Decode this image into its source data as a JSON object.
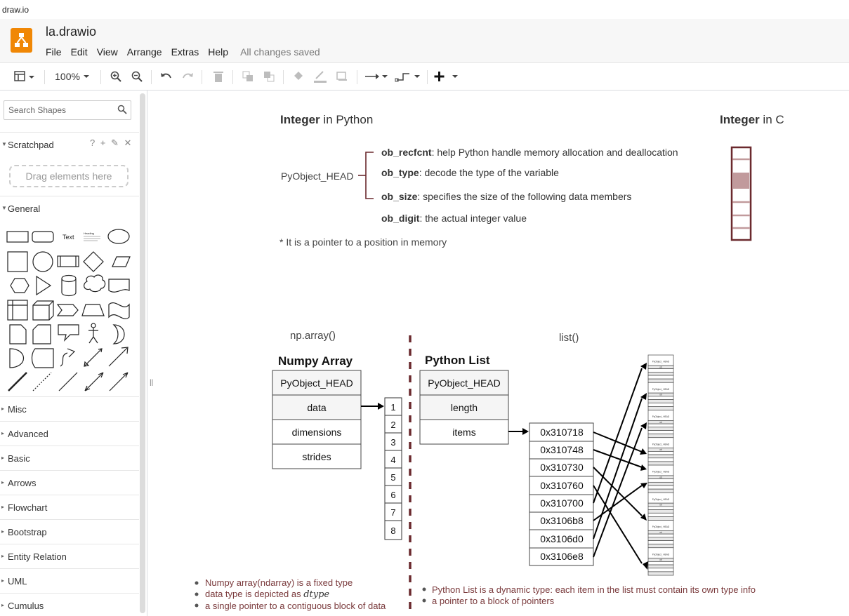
{
  "app": {
    "window_title": "draw.io",
    "doc_title": "la.drawio",
    "save_status": "All changes saved"
  },
  "menu": [
    "File",
    "Edit",
    "View",
    "Arrange",
    "Extras",
    "Help"
  ],
  "toolbar": {
    "zoom": "100%"
  },
  "sidebar": {
    "search_placeholder": "Search Shapes",
    "scratchpad": "Scratchpad",
    "scratchpad_icons": "? + ✎ ✕",
    "drop_hint": "Drag elements here",
    "general": "General",
    "palette_text": "Text",
    "palette_heading": "Heading",
    "sections": [
      "Misc",
      "Advanced",
      "Basic",
      "Arrows",
      "Flowchart",
      "Bootstrap",
      "Entity Relation",
      "UML",
      "Cumulus"
    ]
  },
  "diagram": {
    "int_py_bold": "Integer",
    "int_py_rest": " in Python",
    "int_c_bold": "Integer",
    "int_c_rest": " in C",
    "pyobj_head": "PyObject_HEAD",
    "fields": [
      {
        "name": "ob_recfcnt",
        "desc": ": help Python handle memory allocation and deallocation"
      },
      {
        "name": "ob_type",
        "desc": ": decode the type of the variable"
      },
      {
        "name": "ob_size",
        "desc": ": specifies the size of the following data members"
      },
      {
        "name": "ob_digit",
        "desc": ": the actual integer value"
      }
    ],
    "pointer_note": "* It is a pointer to a position in memory",
    "np_label": "np.array()",
    "list_label": "list()",
    "numpy_title": "Numpy Array",
    "numpy_rows": [
      "PyObject_HEAD",
      "data",
      "dimensions",
      "strides"
    ],
    "np_values": [
      "1",
      "2",
      "3",
      "4",
      "5",
      "6",
      "7",
      "8"
    ],
    "pylist_title": "Python List",
    "pylist_rows": [
      "PyObject_HEAD",
      "length",
      "items"
    ],
    "addresses": [
      "0x310718",
      "0x310748",
      "0x310730",
      "0x310760",
      "0x310700",
      "0x3106b8",
      "0x3106d0",
      "0x3106e8"
    ],
    "np_bullets": [
      "Numpy array(ndarray) is a fixed type",
      "data type is depicted as ",
      "a single pointer to a contiguous block of data"
    ],
    "dtype": "dtype",
    "list_bullets": [
      "Python List is a dynamic type: each item in the list must contain its own type info",
      "a pointer to a block of pointers"
    ],
    "mini_text": [
      "PyObject_ HEAD",
      "ob"
    ],
    "colors": {
      "maroon": "#6b2a2e",
      "fill_shade": "#c19a9c",
      "bullet_red": "#7a3a3c",
      "grey_fill": "#f5f5f5"
    }
  }
}
